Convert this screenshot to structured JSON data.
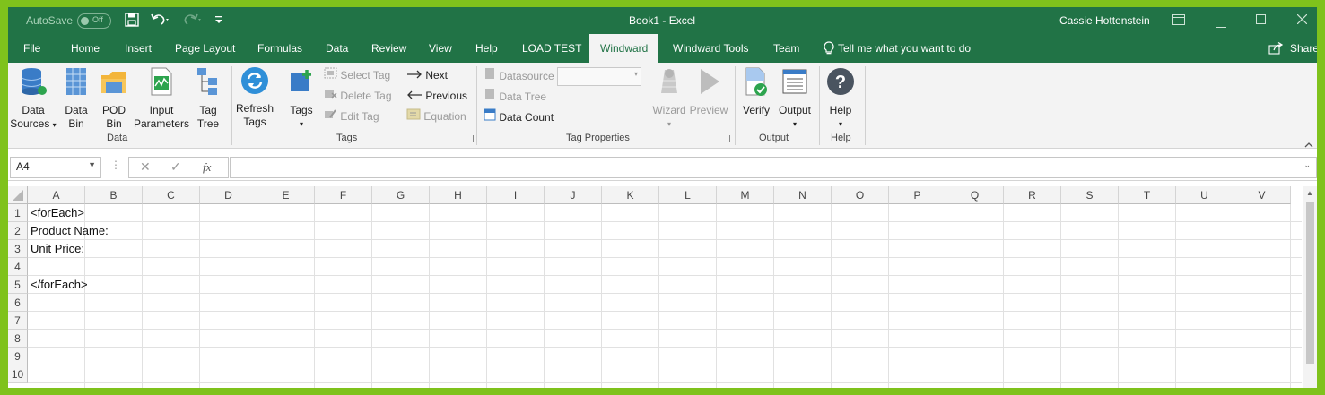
{
  "titlebar": {
    "autosave_label": "AutoSave",
    "autosave_state": "Off",
    "doc_title": "Book1  -  Excel",
    "user_name": "Cassie Hottenstein"
  },
  "tabs": [
    {
      "label": "File"
    },
    {
      "label": "Home"
    },
    {
      "label": "Insert"
    },
    {
      "label": "Page Layout"
    },
    {
      "label": "Formulas"
    },
    {
      "label": "Data"
    },
    {
      "label": "Review"
    },
    {
      "label": "View"
    },
    {
      "label": "Help"
    },
    {
      "label": "LOAD TEST"
    },
    {
      "label": "Windward"
    },
    {
      "label": "Windward Tools"
    },
    {
      "label": "Team"
    }
  ],
  "tell_me": "Tell me what you want to do",
  "share_label": "Share",
  "ribbon": {
    "data_group": {
      "label": "Data",
      "data_sources": [
        "Data",
        "Sources"
      ],
      "data_bin": [
        "Data",
        "Bin"
      ],
      "pod_bin": [
        "POD",
        "Bin"
      ],
      "input_parameters": [
        "Input",
        "Parameters"
      ],
      "tag_tree": [
        "Tag",
        "Tree"
      ]
    },
    "tags_group": {
      "label": "Tags",
      "refresh_tags": [
        "Refresh",
        "Tags"
      ],
      "tags": "Tags",
      "select_tag": "Select Tag",
      "delete_tag": "Delete Tag",
      "edit_tag": "Edit Tag",
      "next": "Next",
      "previous": "Previous",
      "equation": "Equation"
    },
    "tag_properties_group": {
      "label": "Tag Properties",
      "datasource": "Datasource",
      "data_tree": "Data Tree",
      "data_count": "Data Count",
      "wizard": "Wizard",
      "preview": "Preview"
    },
    "output_group": {
      "label": "Output",
      "verify": "Verify",
      "output": "Output"
    },
    "help_group": {
      "label": "Help",
      "help": "Help"
    }
  },
  "formula_bar": {
    "name_box": "A4",
    "fx": "fx",
    "formula": ""
  },
  "sheet": {
    "columns": [
      "A",
      "B",
      "C",
      "D",
      "E",
      "F",
      "G",
      "H",
      "I",
      "J",
      "K",
      "L",
      "M",
      "N",
      "O",
      "P",
      "Q",
      "R",
      "S",
      "T",
      "U",
      "V"
    ],
    "rows": [
      "1",
      "2",
      "3",
      "4",
      "5",
      "6",
      "7",
      "8",
      "9",
      "10"
    ],
    "cells": {
      "A1": "<forEach>",
      "A2": "Product Name:",
      "A3": "Unit Price:",
      "A5": "</forEach>"
    }
  }
}
